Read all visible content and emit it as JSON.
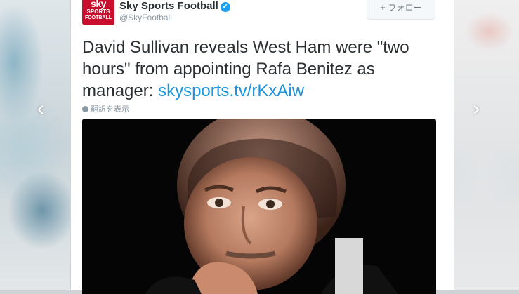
{
  "navigation": {
    "prev_arrow": "‹",
    "next_arrow": "›"
  },
  "tweet": {
    "avatar": {
      "line1": "sky",
      "line2": "SPORTS",
      "line3": "FOOTBALL"
    },
    "display_name": "Sky Sports Football",
    "verified_mark": "✓",
    "handle": "@SkyFootball",
    "follow_button": {
      "icon": "+",
      "label": "フォロー"
    },
    "text": "David Sullivan reveals West Ham were \"two hours\" from appointing Rafa Benitez as manager: ",
    "link": "skysports.tv/rKxAiw",
    "translate_label": "翻訳を表示"
  },
  "colors": {
    "link": "#1b95e0",
    "brand": "#c8102e",
    "verified": "#1da1f2"
  }
}
